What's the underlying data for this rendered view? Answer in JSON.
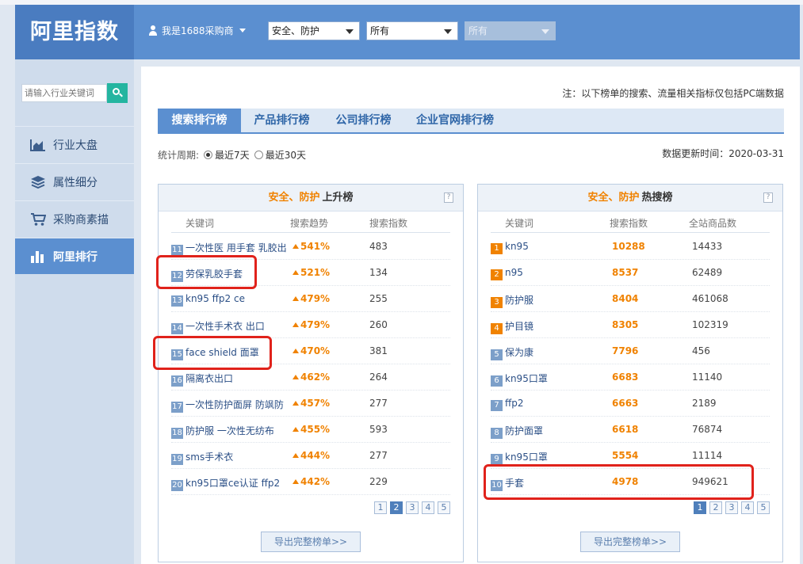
{
  "app": {
    "logo": "阿里指数",
    "user_label": "我是1688采购商"
  },
  "filters": [
    {
      "value": "安全、防护",
      "enabled": true
    },
    {
      "value": "所有",
      "enabled": true
    },
    {
      "value": "所有",
      "enabled": false
    }
  ],
  "search": {
    "placeholder": "请输入行业关键词"
  },
  "sidebar": {
    "items": [
      {
        "label": "行业大盘",
        "icon": "area-chart-icon",
        "active": false
      },
      {
        "label": "属性细分",
        "icon": "layers-icon",
        "active": false
      },
      {
        "label": "采购商素描",
        "icon": "cart-icon",
        "active": false
      },
      {
        "label": "阿里排行",
        "icon": "bar-chart-icon",
        "active": true
      }
    ]
  },
  "note": "注：以下榜单的搜索、流量相关指标仅包括PC端数据",
  "tabs": [
    "搜索排行榜",
    "产品排行榜",
    "公司排行榜",
    "企业官网排行榜"
  ],
  "period": {
    "label": "统计周期:",
    "options": [
      "最近7天",
      "最近30天"
    ],
    "selected": 0
  },
  "updated": "数据更新时间：2020-03-31",
  "rising": {
    "category": "安全、防护",
    "title": "上升榜",
    "columns": [
      "关键词",
      "搜索趋势",
      "搜索指数"
    ],
    "rows": [
      {
        "rank": "11",
        "keyword": "一次性医 用手套 乳胶出",
        "trend": "541%",
        "index": "483"
      },
      {
        "rank": "12",
        "keyword": "劳保乳胶手套",
        "trend": "521%",
        "index": "134"
      },
      {
        "rank": "13",
        "keyword": "kn95 ffp2 ce",
        "trend": "479%",
        "index": "255"
      },
      {
        "rank": "14",
        "keyword": "一次性手术衣 出口",
        "trend": "479%",
        "index": "260"
      },
      {
        "rank": "15",
        "keyword": "face shield 面罩",
        "trend": "470%",
        "index": "381"
      },
      {
        "rank": "16",
        "keyword": "隔离衣出口",
        "trend": "462%",
        "index": "264"
      },
      {
        "rank": "17",
        "keyword": "一次性防护面屏 防飒防",
        "trend": "457%",
        "index": "277"
      },
      {
        "rank": "18",
        "keyword": "防护服 一次性无纺布",
        "trend": "455%",
        "index": "593"
      },
      {
        "rank": "19",
        "keyword": "sms手术衣",
        "trend": "444%",
        "index": "277"
      },
      {
        "rank": "20",
        "keyword": "kn95口罩ce认证 ffp2",
        "trend": "442%",
        "index": "229"
      }
    ],
    "pages": [
      "1",
      "2",
      "3",
      "4",
      "5"
    ],
    "current_page": 1,
    "export_label": "导出完整榜单>>"
  },
  "hot": {
    "category": "安全、防护",
    "title": "热搜榜",
    "columns": [
      "关键词",
      "搜索指数",
      "全站商品数"
    ],
    "rows": [
      {
        "rank": "1",
        "keyword": "kn95",
        "index": "10288",
        "products": "14433"
      },
      {
        "rank": "2",
        "keyword": "n95",
        "index": "8537",
        "products": "62489"
      },
      {
        "rank": "3",
        "keyword": "防护服",
        "index": "8404",
        "products": "461068"
      },
      {
        "rank": "4",
        "keyword": "护目镜",
        "index": "8305",
        "products": "102319"
      },
      {
        "rank": "5",
        "keyword": "保为康",
        "index": "7796",
        "products": "456"
      },
      {
        "rank": "6",
        "keyword": "kn95口罩",
        "index": "6683",
        "products": "11140"
      },
      {
        "rank": "7",
        "keyword": "ffp2",
        "index": "6663",
        "products": "2189"
      },
      {
        "rank": "8",
        "keyword": "防护面罩",
        "index": "6618",
        "products": "76874"
      },
      {
        "rank": "9",
        "keyword": "kn95口罩",
        "index": "5554",
        "products": "11114"
      },
      {
        "rank": "10",
        "keyword": "手套",
        "index": "4978",
        "products": "949621"
      }
    ],
    "pages": [
      "1",
      "2",
      "3",
      "4",
      "5"
    ],
    "current_page": 0,
    "export_label": "导出完整榜单>>"
  },
  "colors": {
    "header": "#5b8fd0",
    "accent": "#f08200",
    "highlight": "#e0221b"
  }
}
